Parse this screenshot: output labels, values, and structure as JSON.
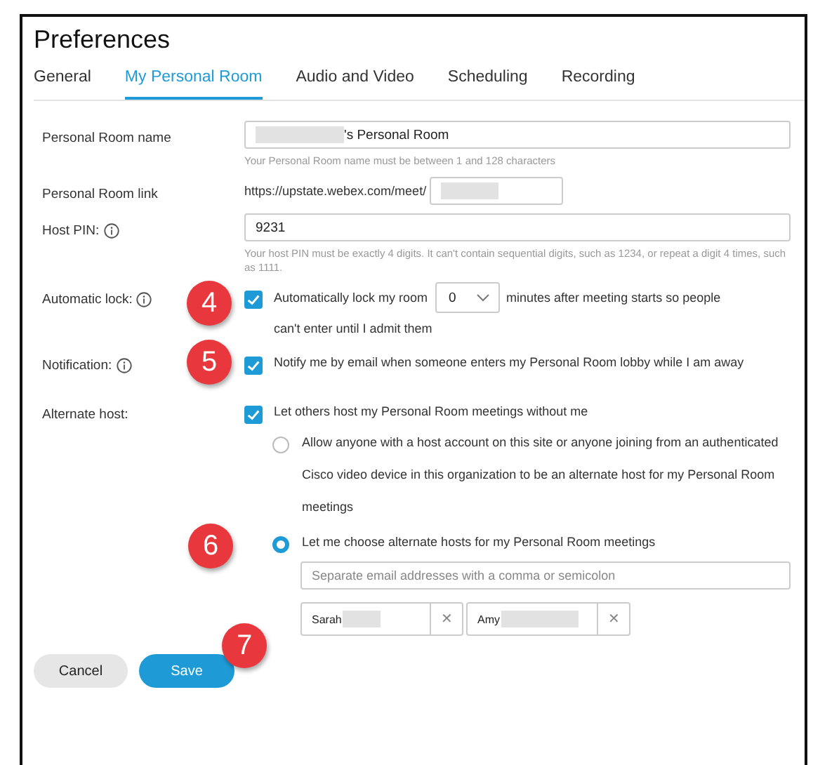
{
  "window": {
    "title": "Preferences"
  },
  "tabs": [
    {
      "label": "General",
      "selected": false
    },
    {
      "label": "My Personal Room",
      "selected": true
    },
    {
      "label": "Audio and Video",
      "selected": false
    },
    {
      "label": "Scheduling",
      "selected": false
    },
    {
      "label": "Recording",
      "selected": false
    }
  ],
  "room_name": {
    "label": "Personal Room name",
    "value": "'s Personal Room",
    "redacted": true,
    "hint": "Your Personal Room name must be between 1 and 128 characters"
  },
  "room_link": {
    "label": "Personal Room link",
    "prefix": "https://upstate.webex.com/meet/",
    "redacted": true
  },
  "host_pin": {
    "label": "Host PIN:",
    "value": "9231",
    "hint": "Your host PIN must be exactly 4 digits. It can't contain sequential digits, such as 1234, or repeat a digit 4 times, such as 1111."
  },
  "automatic_lock": {
    "label": "Automatic lock:",
    "checked": true,
    "text_before": "Automatically lock my room",
    "minutes": "0",
    "text_after": "minutes after meeting starts so people",
    "text_after_2": "can't enter until I admit them",
    "step": "4"
  },
  "notification": {
    "label": "Notification:",
    "checked": true,
    "text": "Notify me by email when someone enters my Personal Room lobby while I am away",
    "step": "5"
  },
  "alternate_host": {
    "label": "Alternate host:",
    "checked": true,
    "text": "Let others host my Personal Room meetings without me",
    "options": [
      {
        "text": "Allow anyone with a host account on this site or anyone joining from an authenticated Cisco video device in this organization to be an alternate host for my Personal Room meetings",
        "selected": false
      },
      {
        "text": "Let me choose alternate hosts for my Personal Room meetings",
        "selected": true,
        "step": "6"
      }
    ],
    "email_placeholder": "Separate email addresses with a comma or semicolon",
    "hosts": [
      {
        "name": "Sarah",
        "remove": "✕"
      },
      {
        "name": "Amy",
        "remove": "✕"
      }
    ]
  },
  "buttons": [
    {
      "label": "Cancel",
      "kind": "secondary"
    },
    {
      "label": "Save",
      "kind": "primary",
      "step": "7"
    }
  ]
}
